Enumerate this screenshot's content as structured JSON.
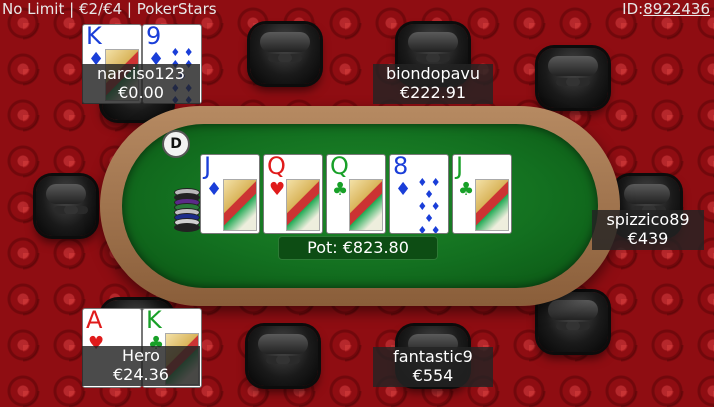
{
  "header": {
    "game_info": "No Limit | €2/€4 | PokerStars",
    "id_label": "ID:",
    "id_value": "8922436"
  },
  "dealer_button": "D",
  "pot": "Pot: €823.80",
  "board": [
    {
      "rank": "J",
      "suit": "♦",
      "color": "blue"
    },
    {
      "rank": "Q",
      "suit": "♥",
      "color": "red"
    },
    {
      "rank": "Q",
      "suit": "♣",
      "color": "green"
    },
    {
      "rank": "8",
      "suit": "♦",
      "color": "blue"
    },
    {
      "rank": "J",
      "suit": "♣",
      "color": "green"
    }
  ],
  "players": {
    "narciso": {
      "name": "narciso123",
      "stack": "€0.00",
      "cards": [
        {
          "rank": "K",
          "suit": "♦",
          "color": "blue"
        },
        {
          "rank": "9",
          "suit": "♦",
          "color": "blue"
        }
      ]
    },
    "biondo": {
      "name": "biondopavu",
      "stack": "€222.91"
    },
    "spizzico": {
      "name": "spizzico89",
      "stack": "€439"
    },
    "fantastic": {
      "name": "fantastic9",
      "stack": "€554"
    },
    "hero": {
      "name": "Hero",
      "stack": "€24.36",
      "cards": [
        {
          "rank": "A",
          "suit": "♥",
          "color": "red"
        },
        {
          "rank": "K",
          "suit": "♣",
          "color": "green"
        }
      ]
    }
  }
}
